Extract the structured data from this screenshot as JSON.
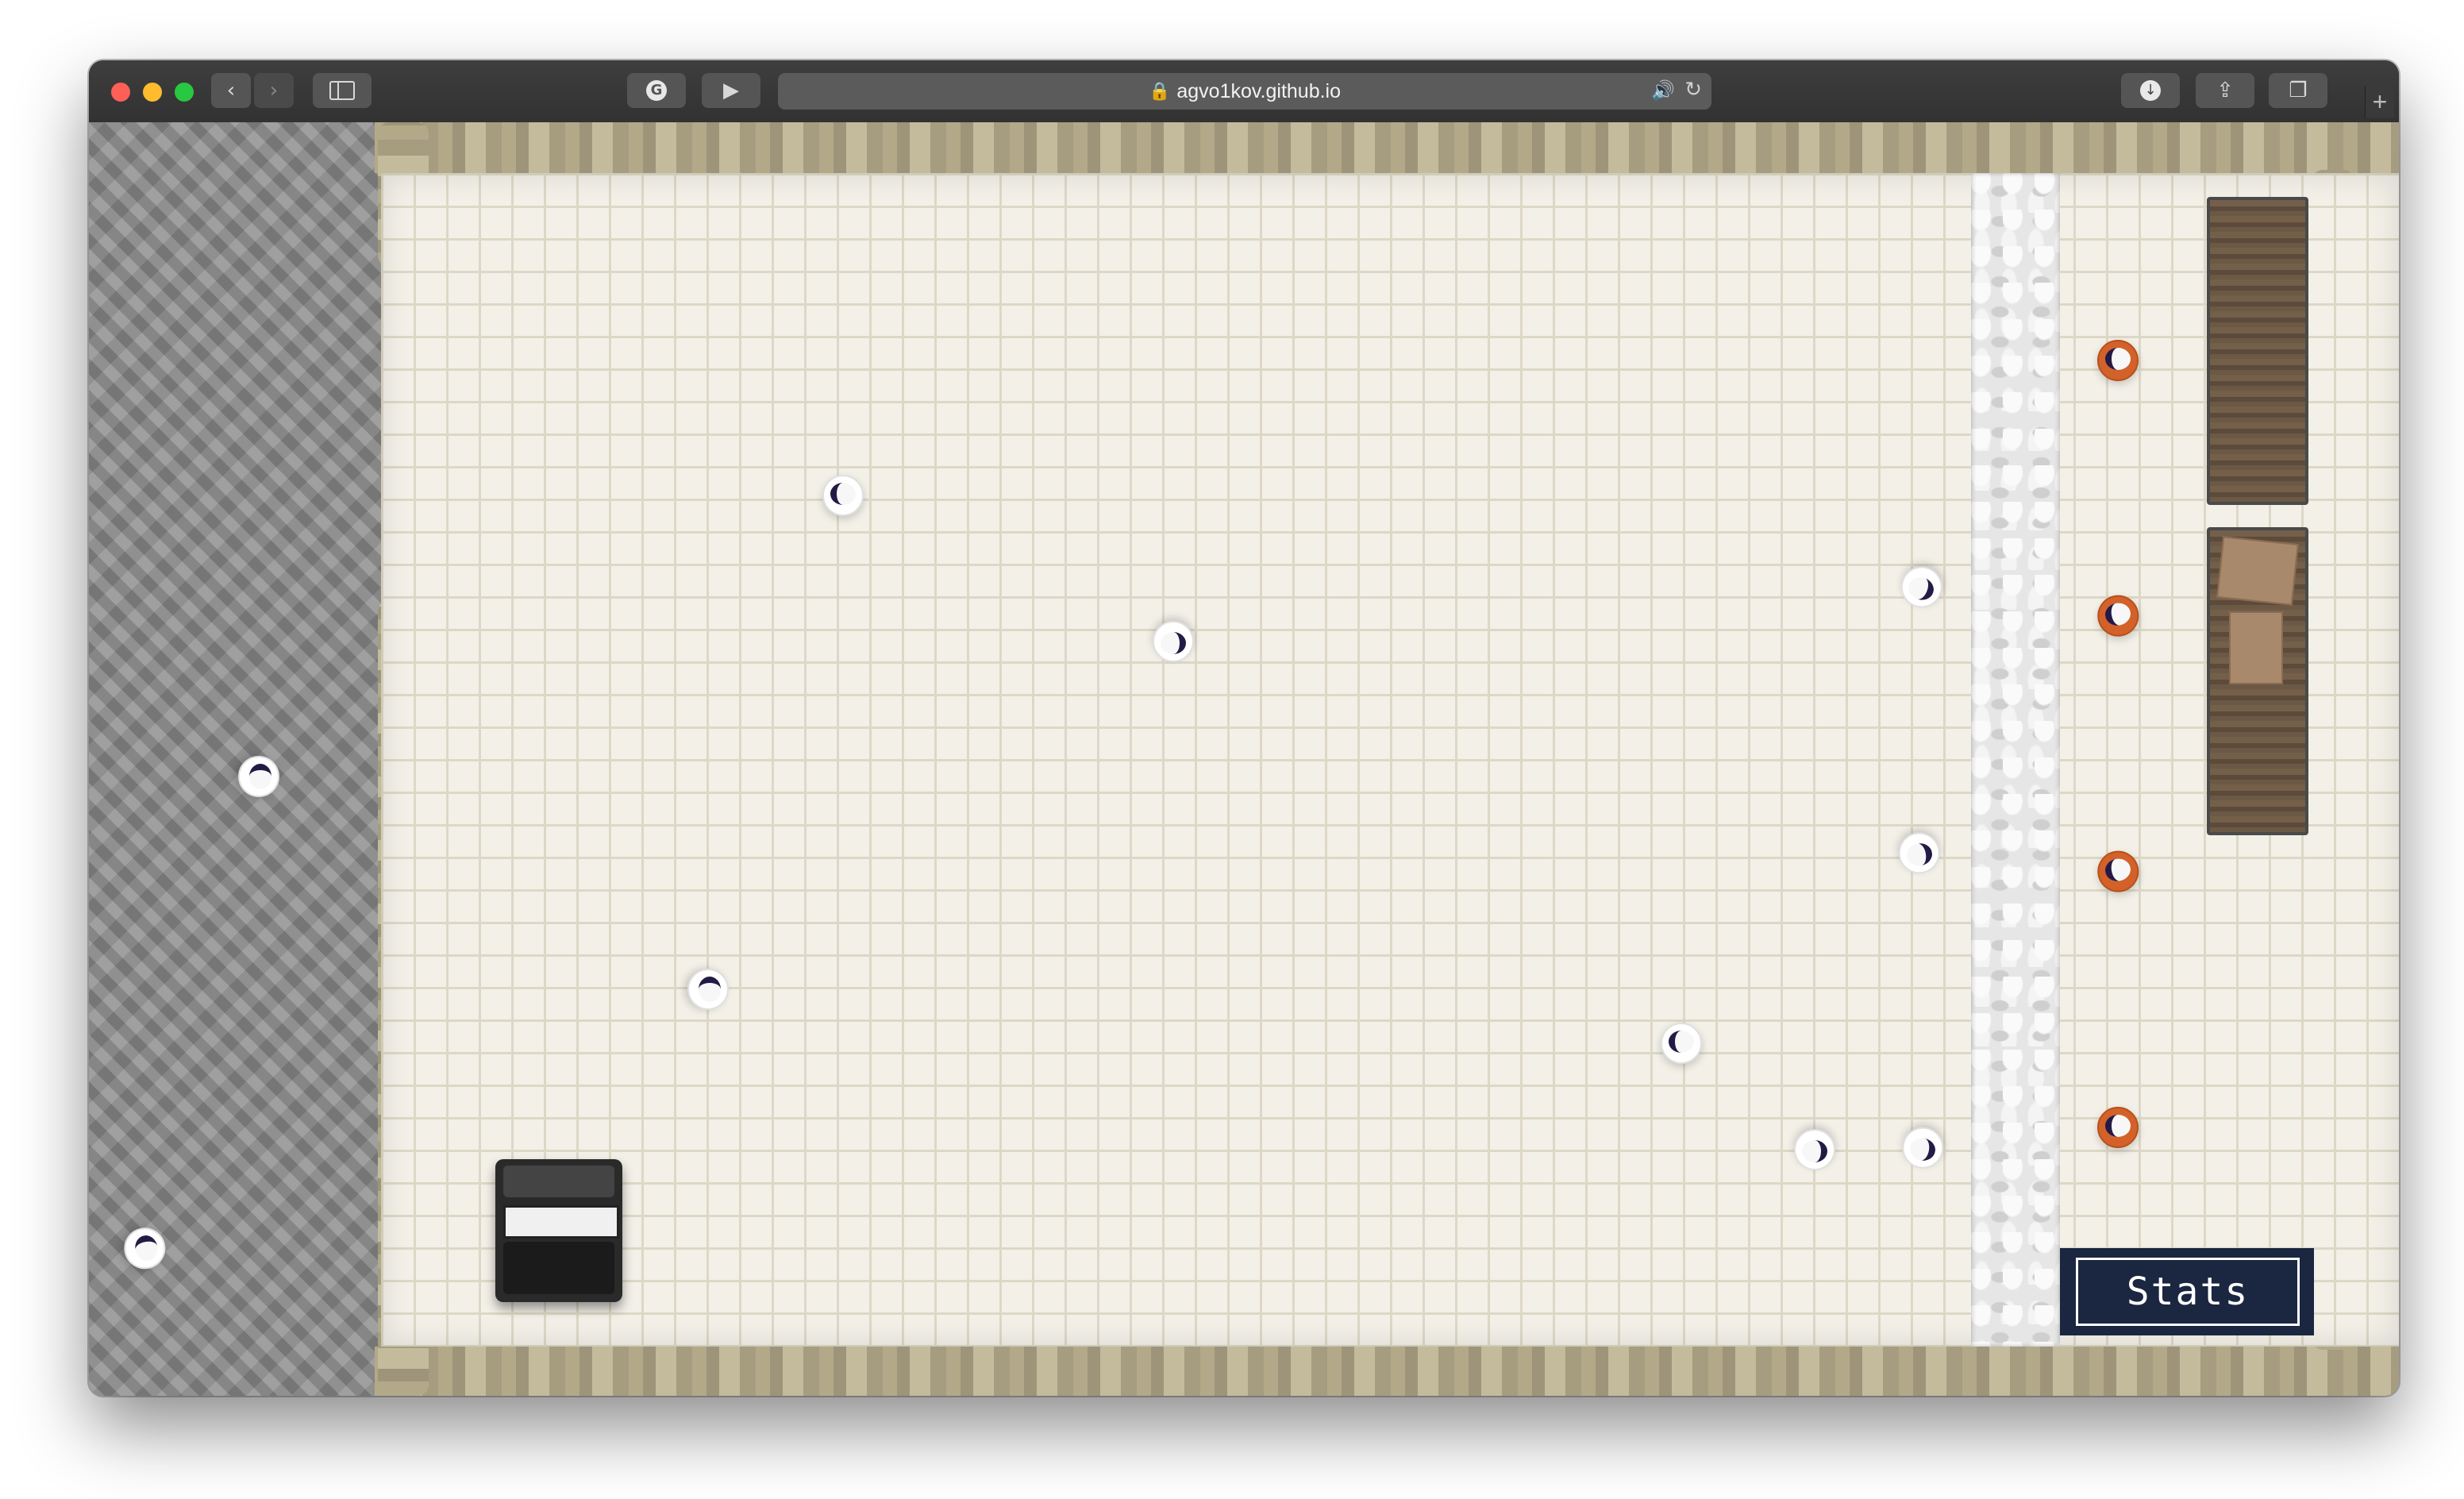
{
  "browser": {
    "url": "agvo1kov.github.io",
    "toolbar": {
      "back_icon": "chevron-left-icon",
      "forward_icon": "chevron-right-icon",
      "sidebar_icon": "sidebar-icon",
      "extension_icon": "grammarly-icon",
      "reader_icon": "play-icon",
      "download_icon": "download-icon",
      "share_icon": "share-icon",
      "tabs_icon": "tabs-icon"
    }
  },
  "game": {
    "stats_button_label": "Stats"
  },
  "colors": {
    "stats_panel": "#1b2640",
    "agent_shirt_white": "#ffffff",
    "agent_shirt_orange": "#d2622a",
    "hair": "#231a46"
  }
}
